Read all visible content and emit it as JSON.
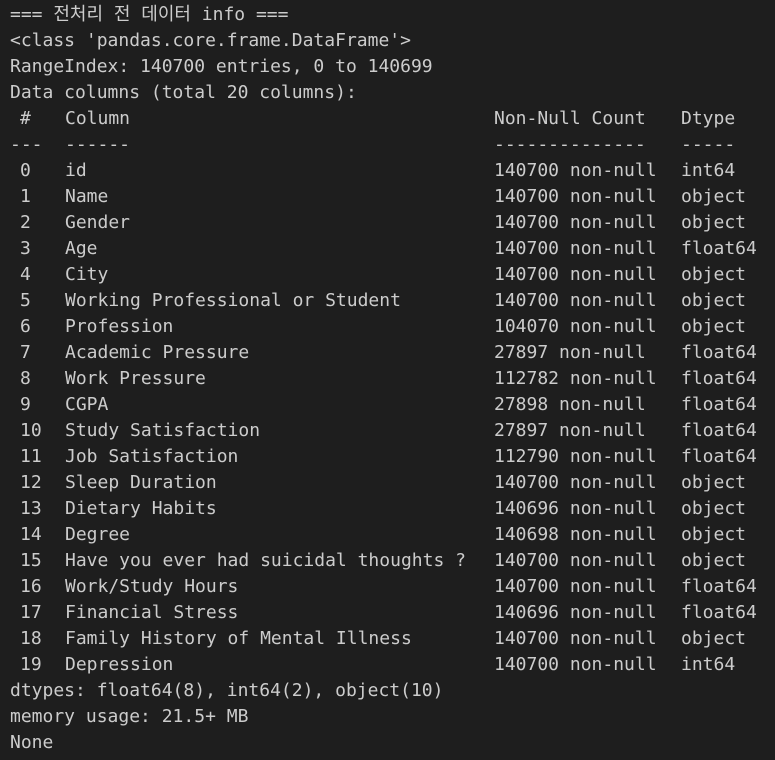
{
  "output": {
    "header": "=== 전처리 전 데이터 info ===",
    "class_line": "<class 'pandas.core.frame.DataFrame'>",
    "range_index": "RangeIndex: 140700 entries, 0 to 140699",
    "data_columns": "Data columns (total 20 columns):",
    "table_headers": {
      "idx": "#",
      "column": "Column",
      "count": "Non-Null Count",
      "dtype": "Dtype"
    },
    "separators": {
      "idx": "---",
      "column": "------",
      "count": "--------------",
      "dtype": "-----"
    },
    "rows": [
      {
        "idx": "0",
        "column": "id",
        "count": "140700 non-null",
        "dtype": "int64"
      },
      {
        "idx": "1",
        "column": "Name",
        "count": "140700 non-null",
        "dtype": "object"
      },
      {
        "idx": "2",
        "column": "Gender",
        "count": "140700 non-null",
        "dtype": "object"
      },
      {
        "idx": "3",
        "column": "Age",
        "count": "140700 non-null",
        "dtype": "float64"
      },
      {
        "idx": "4",
        "column": "City",
        "count": "140700 non-null",
        "dtype": "object"
      },
      {
        "idx": "5",
        "column": "Working Professional or Student",
        "count": "140700 non-null",
        "dtype": "object"
      },
      {
        "idx": "6",
        "column": "Profession",
        "count": "104070 non-null",
        "dtype": "object"
      },
      {
        "idx": "7",
        "column": "Academic Pressure",
        "count": "27897 non-null",
        "dtype": "float64"
      },
      {
        "idx": "8",
        "column": "Work Pressure",
        "count": "112782 non-null",
        "dtype": "float64"
      },
      {
        "idx": "9",
        "column": "CGPA",
        "count": "27898 non-null",
        "dtype": "float64"
      },
      {
        "idx": "10",
        "column": "Study Satisfaction",
        "count": "27897 non-null",
        "dtype": "float64"
      },
      {
        "idx": "11",
        "column": "Job Satisfaction",
        "count": "112790 non-null",
        "dtype": "float64"
      },
      {
        "idx": "12",
        "column": "Sleep Duration",
        "count": "140700 non-null",
        "dtype": "object"
      },
      {
        "idx": "13",
        "column": "Dietary Habits",
        "count": "140696 non-null",
        "dtype": "object"
      },
      {
        "idx": "14",
        "column": "Degree",
        "count": "140698 non-null",
        "dtype": "object"
      },
      {
        "idx": "15",
        "column": "Have you ever had suicidal thoughts ?",
        "count": "140700 non-null",
        "dtype": "object"
      },
      {
        "idx": "16",
        "column": "Work/Study Hours",
        "count": "140700 non-null",
        "dtype": "float64"
      },
      {
        "idx": "17",
        "column": "Financial Stress",
        "count": "140696 non-null",
        "dtype": "float64"
      },
      {
        "idx": "18",
        "column": "Family History of Mental Illness",
        "count": "140700 non-null",
        "dtype": "object"
      },
      {
        "idx": "19",
        "column": "Depression",
        "count": "140700 non-null",
        "dtype": "int64"
      }
    ],
    "dtypes_line": "dtypes: float64(8), int64(2), object(10)",
    "memory_line": "memory usage: 21.5+ MB",
    "return_line": "None"
  }
}
